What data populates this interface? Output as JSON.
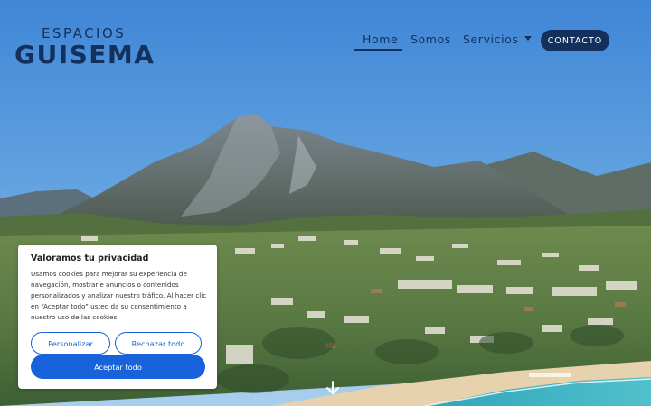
{
  "logo": {
    "line1": "ESPACIOS",
    "line2": "GUISEMA"
  },
  "nav": {
    "items": [
      {
        "label": "Home",
        "active": true
      },
      {
        "label": "Somos"
      },
      {
        "label": "Servicios"
      }
    ],
    "contact_label": "CONTACTO"
  },
  "cookie_banner": {
    "title": "Valoramos tu privacidad",
    "text": "Usamos cookies para mejorar su experiencia de navegación, mostrarle anuncios o contenidos personalizados y analizar nuestro tráfico. Al hacer clic en “Aceptar todo” usted da su consentimiento a nuestro uso de las cookies.",
    "customize_label": "Personalizar",
    "reject_label": "Rechazar todo",
    "accept_label": "Aceptar todo"
  },
  "colors": {
    "brand_navy": "#13315c",
    "cookie_blue": "#1863dc",
    "sky": "#4b8fd6"
  },
  "icons": {
    "scroll": "arrow-down-icon",
    "dropdown": "chevron-down-icon"
  }
}
